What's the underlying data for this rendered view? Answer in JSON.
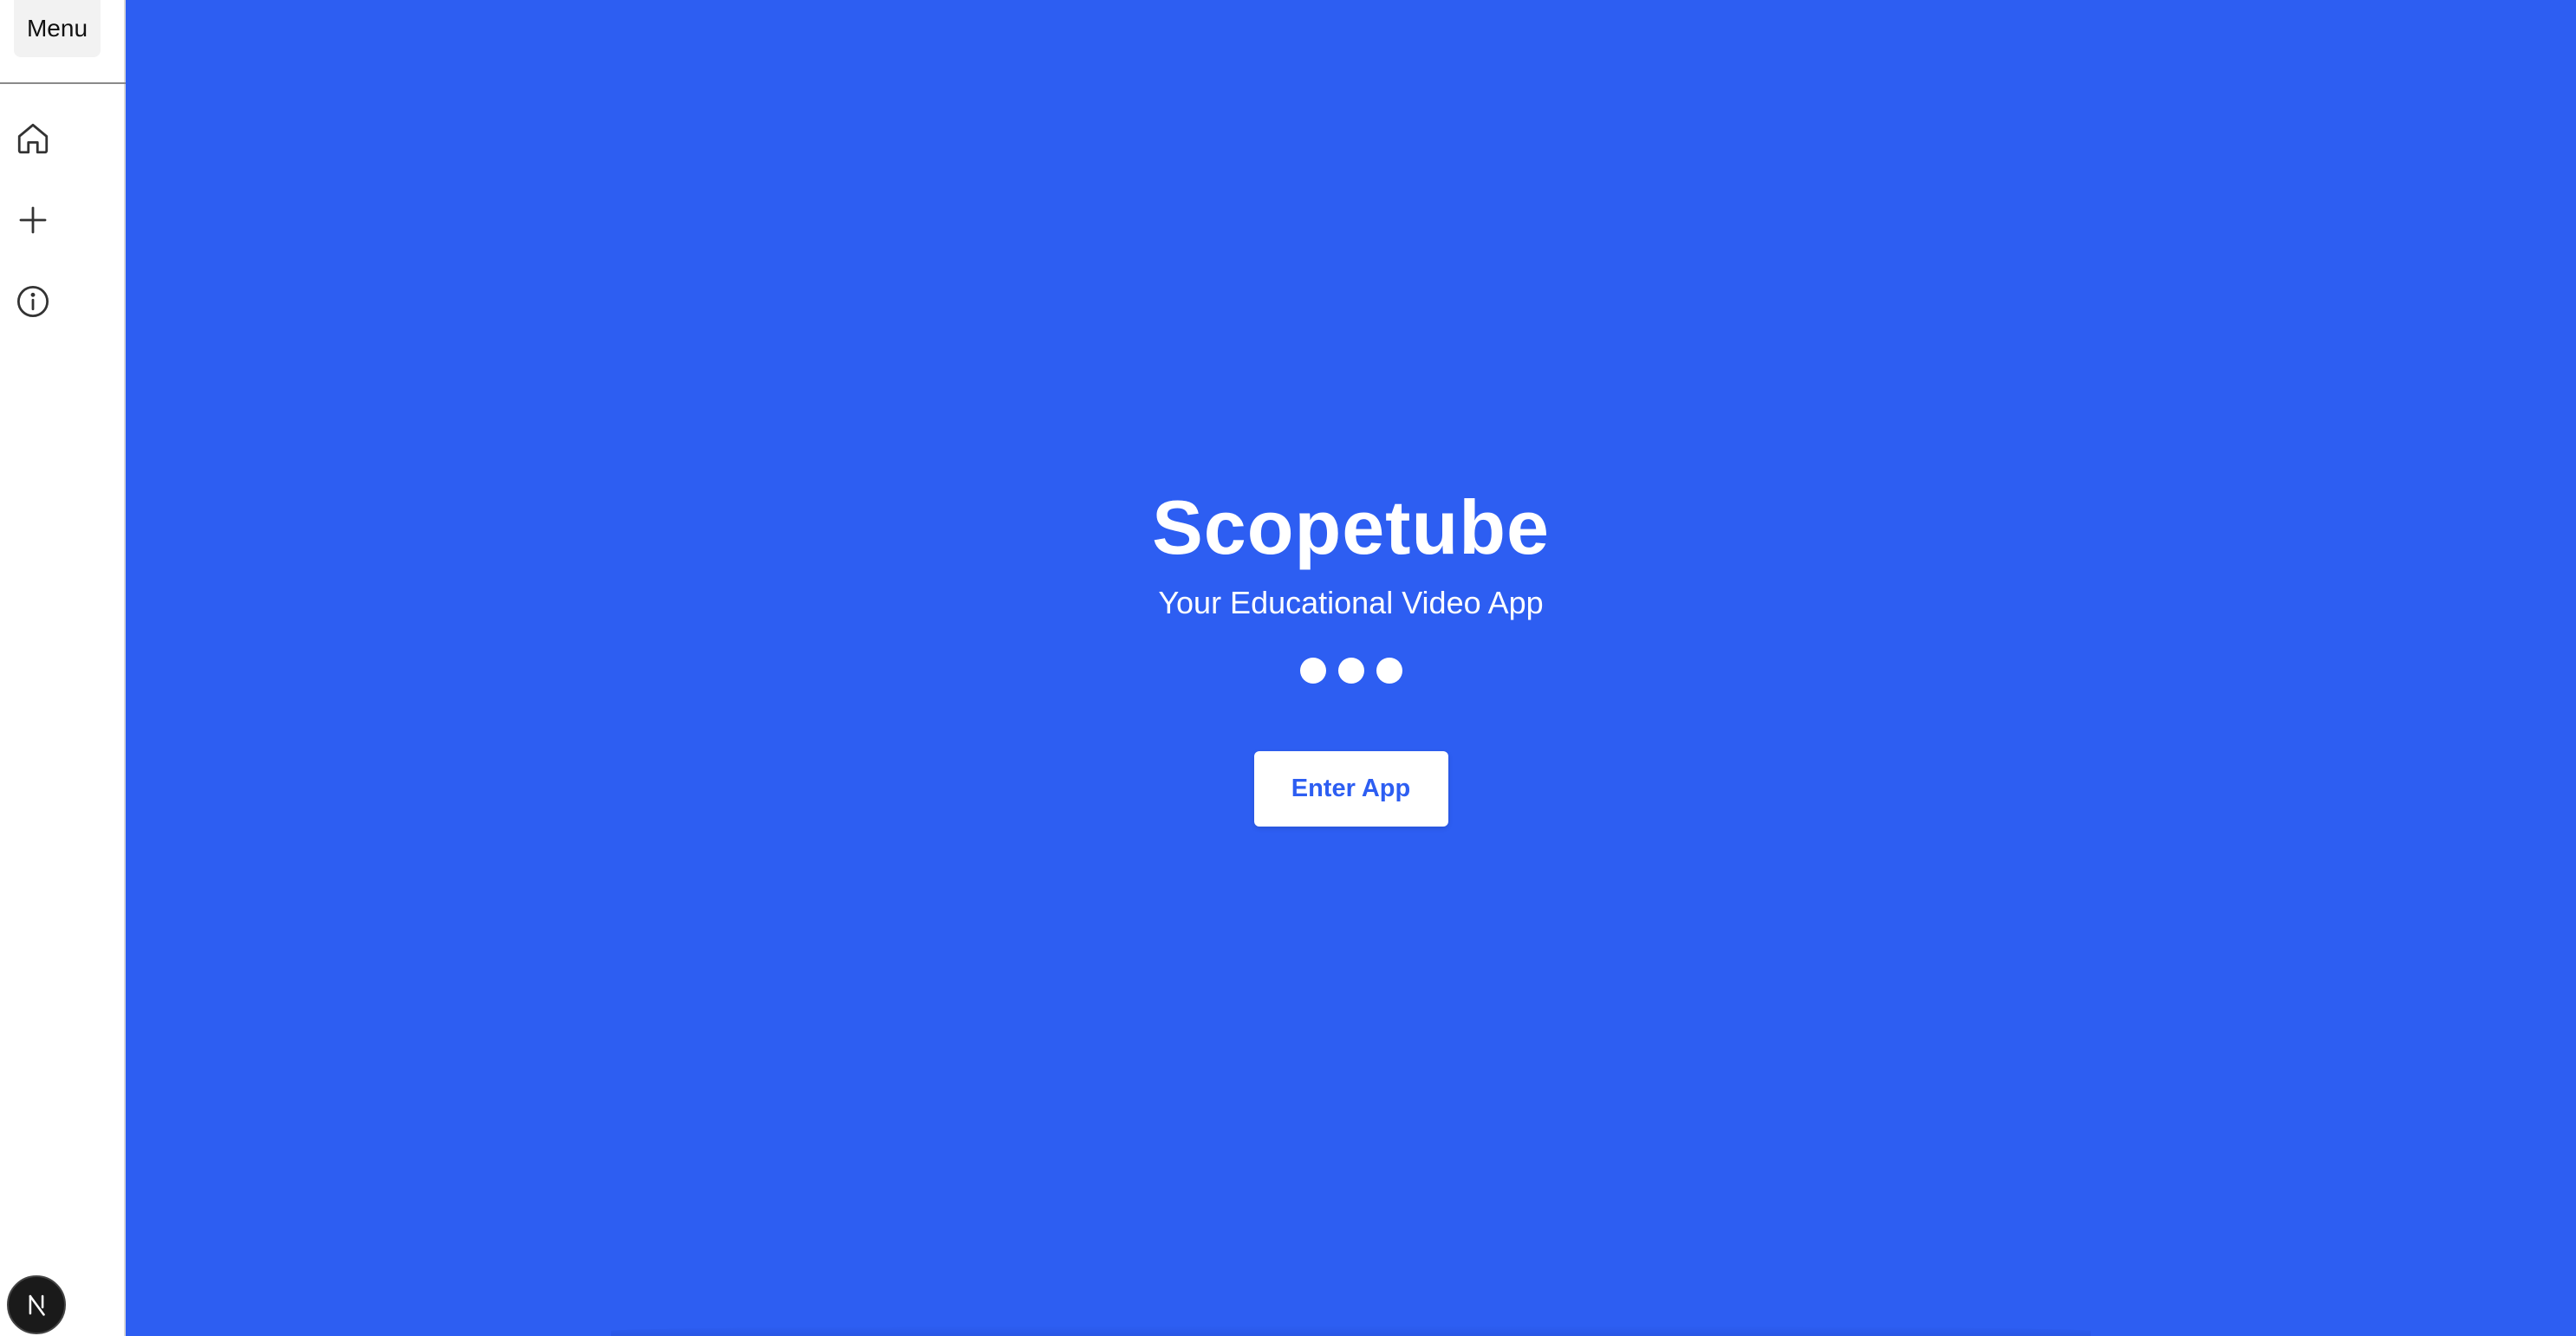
{
  "sidebar": {
    "menu_label": "Menu",
    "nav": [
      {
        "icon": "home-icon"
      },
      {
        "icon": "plus-icon"
      },
      {
        "icon": "info-icon"
      }
    ],
    "avatar_icon": "n-logo-icon"
  },
  "hero": {
    "title": "Scopetube",
    "subtitle": "Your Educational Video App",
    "button_label": "Enter App"
  },
  "colors": {
    "background": "#2d5ef2",
    "sidebar": "#ffffff",
    "text_on_blue": "#ffffff",
    "button_text": "#2d5ef2"
  }
}
